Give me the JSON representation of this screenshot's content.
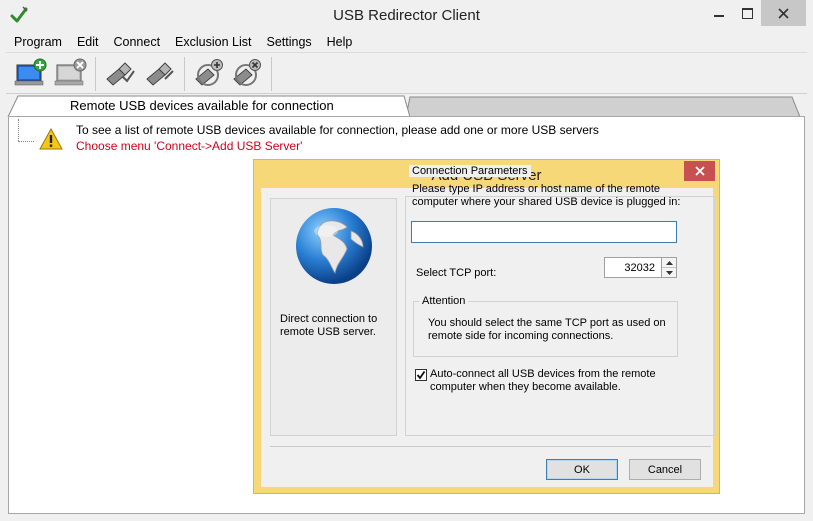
{
  "window": {
    "title": "USB Redirector Client"
  },
  "menu": [
    "Program",
    "Edit",
    "Connect",
    "Exclusion List",
    "Settings",
    "Help"
  ],
  "toolbar": {
    "buttons": [
      "add-server-icon",
      "remove-server-icon",
      "connect-device-icon",
      "disconnect-device-icon",
      "add-exclusion-icon",
      "remove-exclusion-icon"
    ]
  },
  "tab": {
    "label": "Remote USB devices available for connection"
  },
  "message": {
    "line1": "To see a list of remote USB devices available for connection, please add one or more USB servers",
    "line2": "Choose menu 'Connect->Add USB Server'"
  },
  "dialog": {
    "title": "Add USB Server",
    "left_caption": "Direct connection to remote USB server.",
    "params_legend": "Connection Parameters",
    "params_desc": "Please type IP address or host name of the remote computer where your shared USB device is plugged in:",
    "host_value": "",
    "tcp_label": "Select TCP port:",
    "tcp_port": "32032",
    "attention_legend": "Attention",
    "attention_text": "You should select the same TCP port as used on remote side for incoming connections.",
    "auto_connect_label": "Auto-connect all USB devices from the remote computer when they become available.",
    "auto_connect_checked": true,
    "ok_label": "OK",
    "cancel_label": "Cancel"
  },
  "colors": {
    "dialog_frame": "#f7d878",
    "close_button": "#c75050",
    "warning_text": "#d0021b",
    "accent": "#3c7fb1"
  }
}
